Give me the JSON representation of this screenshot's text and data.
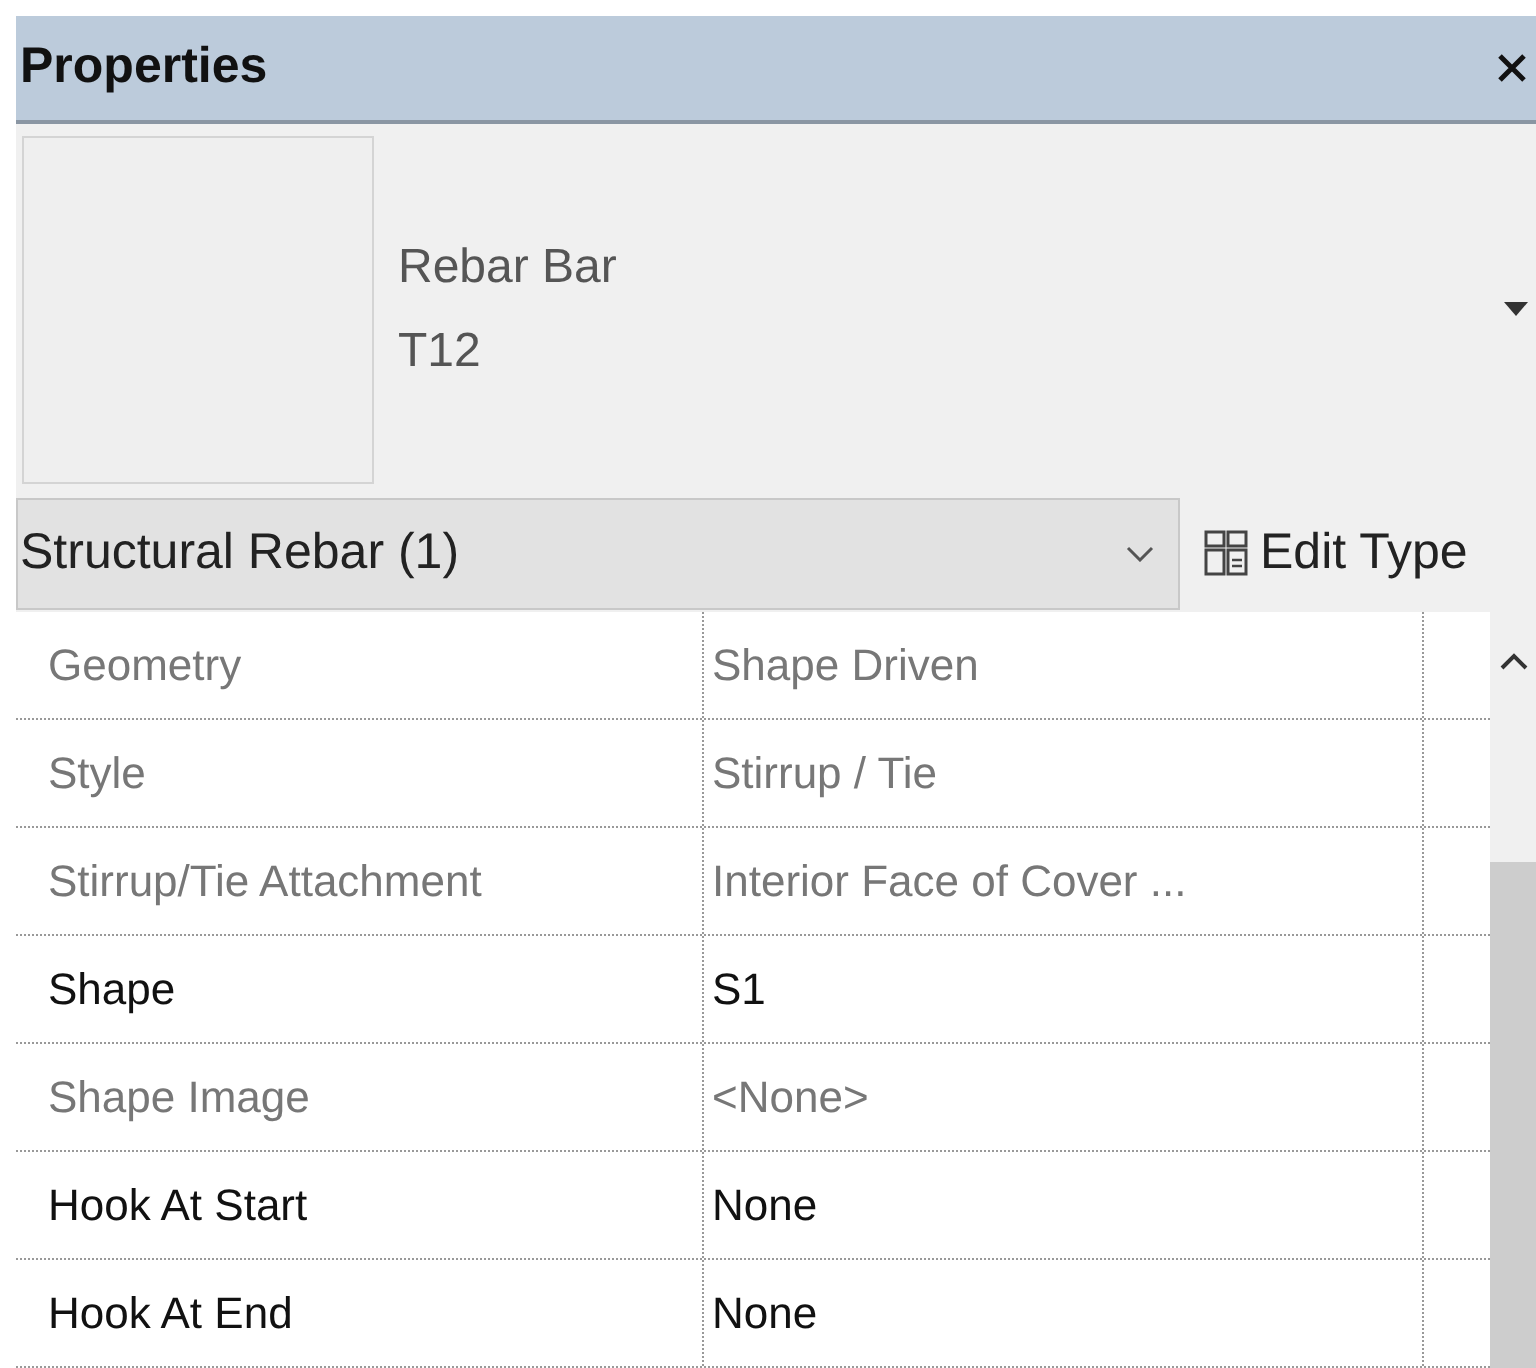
{
  "panel": {
    "title": "Properties"
  },
  "type_selector": {
    "family": "Rebar Bar",
    "type": "T12"
  },
  "filter": {
    "value": "Structural Rebar (1)",
    "edit_type_label": "Edit Type"
  },
  "properties": [
    {
      "name": "Geometry",
      "value": "Shape Driven",
      "disabled": true
    },
    {
      "name": "Style",
      "value": "Stirrup / Tie",
      "disabled": true
    },
    {
      "name": "Stirrup/Tie Attachment",
      "value": "Interior Face of Cover ...",
      "disabled": true
    },
    {
      "name": "Shape",
      "value": "S1",
      "disabled": false
    },
    {
      "name": "Shape Image",
      "value": "<None>",
      "disabled": true
    },
    {
      "name": "Hook At Start",
      "value": "None",
      "disabled": false
    },
    {
      "name": "Hook At End",
      "value": "None",
      "disabled": false
    }
  ]
}
